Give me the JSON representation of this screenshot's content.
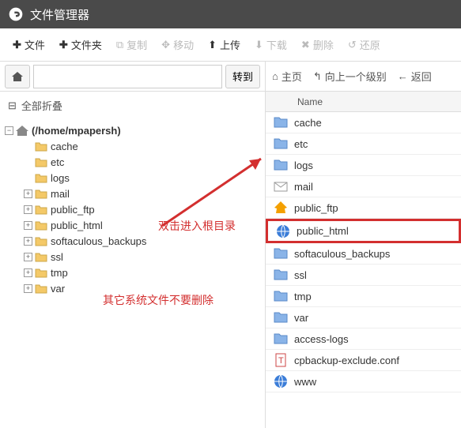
{
  "header": {
    "title": "文件管理器"
  },
  "toolbar": {
    "file": "文件",
    "folder": "文件夹",
    "copy": "复制",
    "move": "移动",
    "upload": "上传",
    "download": "下载",
    "delete": "删除",
    "restore": "还原"
  },
  "nav": {
    "go": "转到",
    "path": ""
  },
  "collapse": "全部折叠",
  "tree": {
    "root": "(/home/mpapersh)",
    "items": [
      {
        "label": "cache",
        "exp": ""
      },
      {
        "label": "etc",
        "exp": ""
      },
      {
        "label": "logs",
        "exp": ""
      },
      {
        "label": "mail",
        "exp": "+"
      },
      {
        "label": "public_ftp",
        "exp": "+"
      },
      {
        "label": "public_html",
        "exp": "+"
      },
      {
        "label": "softaculous_backups",
        "exp": "+"
      },
      {
        "label": "ssl",
        "exp": "+"
      },
      {
        "label": "tmp",
        "exp": "+"
      },
      {
        "label": "var",
        "exp": "+"
      }
    ]
  },
  "rnav": {
    "home": "主页",
    "up": "向上一个级别",
    "back": "返回"
  },
  "table": {
    "name_header": "Name"
  },
  "files": [
    {
      "name": "cache",
      "icon": "folder"
    },
    {
      "name": "etc",
      "icon": "folder"
    },
    {
      "name": "logs",
      "icon": "folder"
    },
    {
      "name": "mail",
      "icon": "mail"
    },
    {
      "name": "public_ftp",
      "icon": "ftp"
    },
    {
      "name": "public_html",
      "icon": "globe",
      "highlight": true
    },
    {
      "name": "softaculous_backups",
      "icon": "folder"
    },
    {
      "name": "ssl",
      "icon": "folder"
    },
    {
      "name": "tmp",
      "icon": "folder"
    },
    {
      "name": "var",
      "icon": "folder"
    },
    {
      "name": "access-logs",
      "icon": "folder"
    },
    {
      "name": "cpbackup-exclude.conf",
      "icon": "text"
    },
    {
      "name": "www",
      "icon": "globe"
    }
  ],
  "annotations": {
    "a1": "双击进入根目录",
    "a2": "其它系统文件不要删除"
  }
}
